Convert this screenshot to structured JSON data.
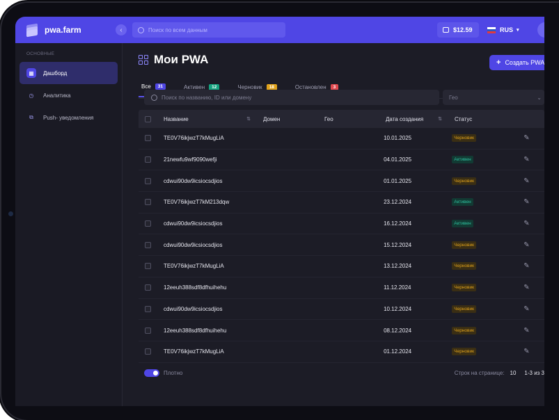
{
  "app": {
    "name": "pwa.farm"
  },
  "topbar": {
    "search_placeholder": "Поиск по всем данным",
    "balance": "$12.59",
    "language": "RUS"
  },
  "sidebar": {
    "section_label": "ОСНОВНЫЕ",
    "items": [
      {
        "label": "Дашборд",
        "icon": "dashboard-icon",
        "active": true
      },
      {
        "label": "Аналитика",
        "icon": "analytics-icon",
        "active": false
      },
      {
        "label": "Push- уведомления",
        "icon": "push-notifications-icon",
        "active": false
      }
    ]
  },
  "page": {
    "title": "Мои PWA",
    "create_button": "Создать PWA"
  },
  "tabs": [
    {
      "label": "Все",
      "count": "31",
      "color": "#4f46e5",
      "active": true
    },
    {
      "label": "Активен",
      "count": "12",
      "color": "#14a37f",
      "active": false
    },
    {
      "label": "Черновик",
      "count": "18",
      "color": "#e0a21b",
      "active": false
    },
    {
      "label": "Остановлен",
      "count": "3",
      "color": "#e0484e",
      "active": false
    }
  ],
  "filters": {
    "search_placeholder": "Поиск по названию, ID или домену",
    "geo_placeholder": "Гео"
  },
  "table": {
    "columns": [
      "Название",
      "Домен",
      "Гео",
      "Дата создания",
      "Статус"
    ],
    "rows": [
      {
        "name": "TE0V76ikjwzT7kMugLiA",
        "domain": "",
        "geo": "",
        "date": "10.01.2025",
        "status": "Черновик"
      },
      {
        "name": "21newfu9wf9090wefji",
        "domain": "",
        "geo": "",
        "date": "04.01.2025",
        "status": "Активен"
      },
      {
        "name": "cdwui90dw9icsiocsdjios",
        "domain": "",
        "geo": "",
        "date": "01.01.2025",
        "status": "Черновик"
      },
      {
        "name": "TE0V76ikjwzT7kM213dqw",
        "domain": "",
        "geo": "",
        "date": "23.12.2024",
        "status": "Активен"
      },
      {
        "name": "cdwui90dw9icsiocsdjios",
        "domain": "",
        "geo": "",
        "date": "16.12.2024",
        "status": "Активен"
      },
      {
        "name": "cdwui90dw9icsiocsdjios",
        "domain": "",
        "geo": "",
        "date": "15.12.2024",
        "status": "Черновик"
      },
      {
        "name": "TE0V76ikjwzT7kMugLiA",
        "domain": "",
        "geo": "",
        "date": "13.12.2024",
        "status": "Черновик"
      },
      {
        "name": "12eeuh388sdf8dfhuihehu",
        "domain": "",
        "geo": "",
        "date": "11.12.2024",
        "status": "Черновик"
      },
      {
        "name": "cdwui90dw9icsiocsdjios",
        "domain": "",
        "geo": "",
        "date": "10.12.2024",
        "status": "Черновик"
      },
      {
        "name": "12eeuh388sdf8dfhuihehu",
        "domain": "",
        "geo": "",
        "date": "08.12.2024",
        "status": "Черновик"
      },
      {
        "name": "TE0V76ikjwzT7kMugLiA",
        "domain": "",
        "geo": "",
        "date": "01.12.2024",
        "status": "Черновик"
      }
    ]
  },
  "footer": {
    "toggle_label": "Плотно",
    "rows_per_page_label": "Строк на странице:",
    "rows_per_page": "10",
    "range": "1-3 из 3"
  },
  "status_colors": {
    "Черновик": {
      "bg": "#3a2e14",
      "fg": "#e0a21b"
    },
    "Активен": {
      "bg": "#123a33",
      "fg": "#2fc2a0"
    }
  },
  "colors": {
    "accent": "#4f46e5",
    "background": "#1c1c26"
  }
}
